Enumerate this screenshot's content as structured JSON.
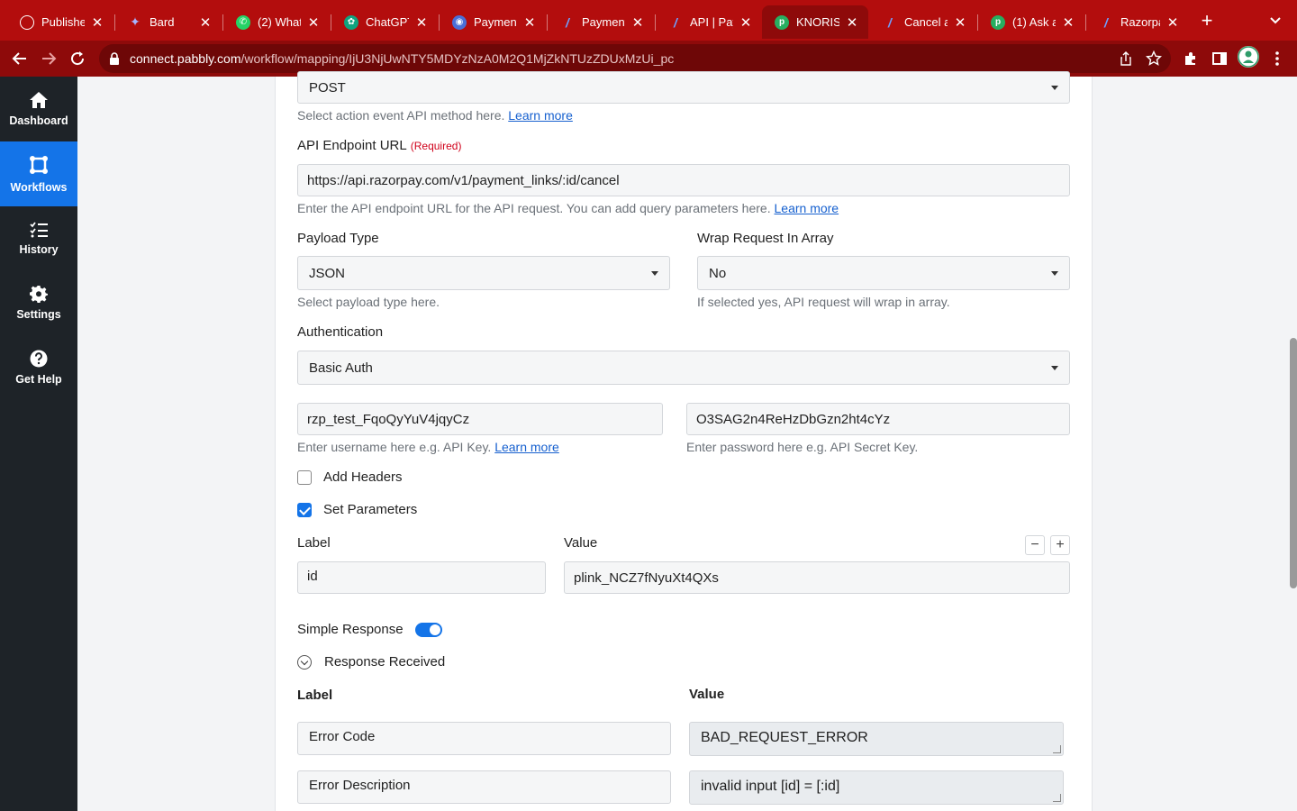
{
  "browser": {
    "tabs": [
      {
        "title": "Publisher",
        "favicon": "circle-icon",
        "color": "#c0392b"
      },
      {
        "title": "Bard",
        "favicon": "sparkle-icon",
        "color": "#5b6ee1"
      },
      {
        "title": "(2) What",
        "favicon": "whatsapp-icon",
        "color": "#25d366"
      },
      {
        "title": "ChatGPT",
        "favicon": "chatgpt-icon",
        "color": "#10a37f"
      },
      {
        "title": "Payment",
        "favicon": "eye-icon",
        "color": "#4a6fd8"
      },
      {
        "title": "Payment",
        "favicon": "razorpay-icon",
        "color": "#2b6bf3"
      },
      {
        "title": "API | Pay",
        "favicon": "razorpay-icon",
        "color": "#2b6bf3"
      },
      {
        "title": "KNORISH",
        "favicon": "pabbly-icon",
        "color": "#27ae60"
      },
      {
        "title": "Cancel a",
        "favicon": "razorpay-icon",
        "color": "#2b6bf3"
      },
      {
        "title": "(1) Ask a",
        "favicon": "pabbly-icon",
        "color": "#27ae60"
      },
      {
        "title": "Razorpay",
        "favicon": "razorpay-icon",
        "color": "#2b6bf3"
      }
    ],
    "url_host": "connect.pabbly.com",
    "url_path": "/workflow/mapping/IjU3NjUwNTY5MDYzNzA0M2Q1MjZkNTUzZDUxMzUi_pc"
  },
  "sidebar": {
    "items": [
      {
        "label": "Dashboard",
        "icon": "home-icon"
      },
      {
        "label": "Workflows",
        "icon": "workflow-icon",
        "active": true
      },
      {
        "label": "History",
        "icon": "list-icon"
      },
      {
        "label": "Settings",
        "icon": "gear-icon"
      },
      {
        "label": "Get Help",
        "icon": "help-icon"
      }
    ]
  },
  "form": {
    "method_value": "POST",
    "method_help": "Select action event API method here.",
    "learn_more": "Learn more",
    "endpoint_label": "API Endpoint URL",
    "required": "(Required)",
    "endpoint_value": "https://api.razorpay.com/v1/payment_links/:id/cancel",
    "endpoint_help": "Enter the API endpoint URL for the API request. You can add query parameters here.",
    "payload_label": "Payload Type",
    "payload_value": "JSON",
    "payload_help": "Select payload type here.",
    "wrap_label": "Wrap Request In Array",
    "wrap_value": "No",
    "wrap_help": "If selected yes, API request will wrap in array.",
    "auth_label": "Authentication",
    "auth_value": "Basic Auth",
    "username_value": "rzp_test_FqoQyYuV4jqyCz",
    "username_help": "Enter username here e.g. API Key.",
    "password_value": "O3SAG2n4ReHzDbGzn2ht4cYz",
    "password_help": "Enter password here e.g. API Secret Key.",
    "add_headers_label": "Add Headers",
    "set_params_label": "Set Parameters",
    "param_label_header": "Label",
    "param_value_header": "Value",
    "param_label_value": "id",
    "param_value_value": "plink_NCZ7fNyuXt4QXs",
    "minus": "−",
    "plus": "+",
    "simple_response_label": "Simple Response",
    "response_received_label": "Response Received",
    "resp_label_header": "Label",
    "resp_value_header": "Value",
    "responses": [
      {
        "label": "Error Code",
        "value": "BAD_REQUEST_ERROR"
      },
      {
        "label": "Error Description",
        "value": "invalid input [id] = [:id]"
      }
    ]
  }
}
